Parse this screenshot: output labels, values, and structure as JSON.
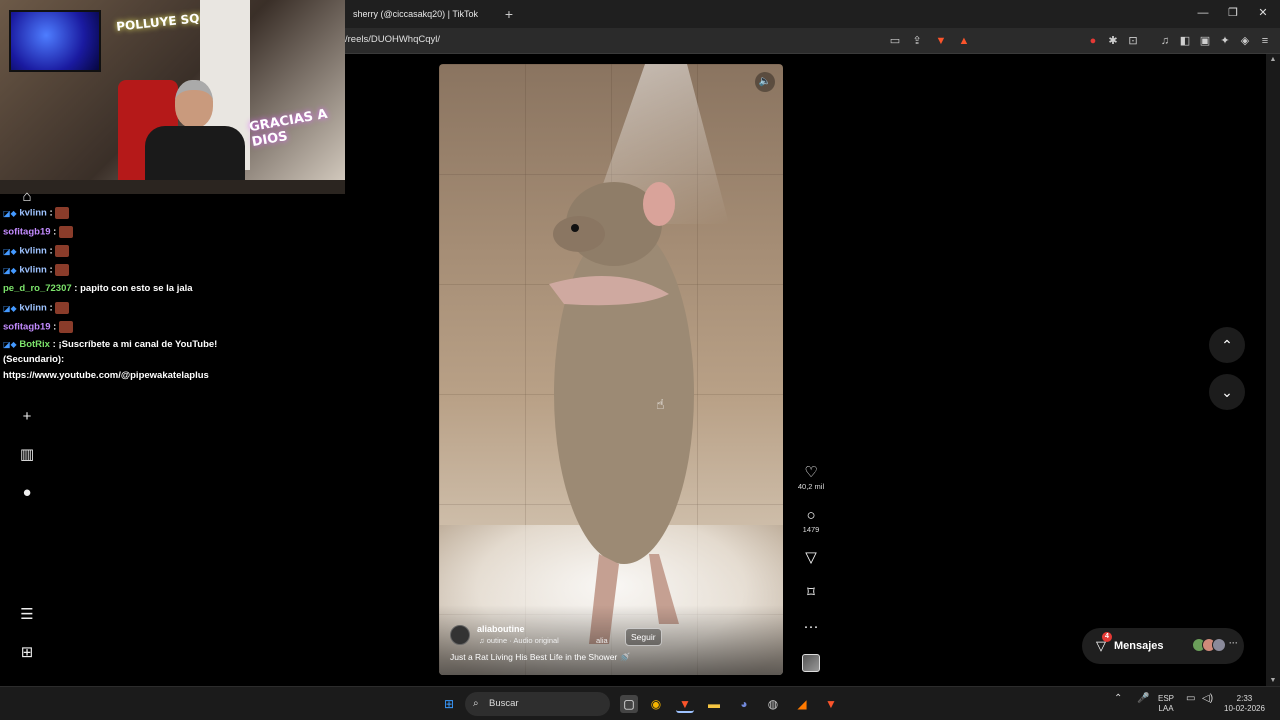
{
  "browser": {
    "tab_title": "sherry (@ciccasakq20) | TikTok",
    "new_tab": "+",
    "url": "/reels/DUOHWhqCqyl/",
    "min": "—",
    "restore": "❐",
    "close": "✕"
  },
  "video": {
    "author": "aliaboutine",
    "audio": "♫ outine · Audio original",
    "audio_extra": "alia",
    "follow_label": "Seguir",
    "caption": "Just a Rat Living His Best Life in the Shower 🚿"
  },
  "actions": {
    "likes": "40,2 mil",
    "comments": "1479",
    "more": "···"
  },
  "messages": {
    "label": "Mensajes",
    "badge": "4",
    "more": "···"
  },
  "stream": {
    "neon_top": "POLLUYE SQUAD",
    "neon_bottom": "GRACIAS A DIOS"
  },
  "chat": [
    {
      "user": "kvlinn",
      "text": "",
      "color": "#9ec3ff"
    },
    {
      "user": "sofitagb19",
      "text": "",
      "color": "#c38bff"
    },
    {
      "user": "kvlinn",
      "text": "",
      "color": "#9ec3ff"
    },
    {
      "user": "kvlinn",
      "text": "",
      "color": "#9ec3ff"
    },
    {
      "user": "pe_d_ro_72307",
      "text": "papito con esto se la jala",
      "color": "#7ce36b"
    },
    {
      "user": "kvlinn",
      "text": "",
      "color": "#9ec3ff"
    },
    {
      "user": "sofitagb19",
      "text": "",
      "color": "#c38bff"
    },
    {
      "user": "BotRix",
      "text": "¡Suscríbete a mi canal de YouTube!",
      "color": "#7ce36b"
    },
    {
      "user": "",
      "text": "(Secundario):",
      "color": "#ffffff"
    },
    {
      "user": "",
      "text": "https://www.youtube.com/@pipewakatelaplus",
      "color": "#ffffff"
    }
  ],
  "taskbar": {
    "search": "Buscar",
    "lang": "ESP",
    "lang2": "LAA",
    "time": "2:33",
    "date": "10-02-2026"
  }
}
